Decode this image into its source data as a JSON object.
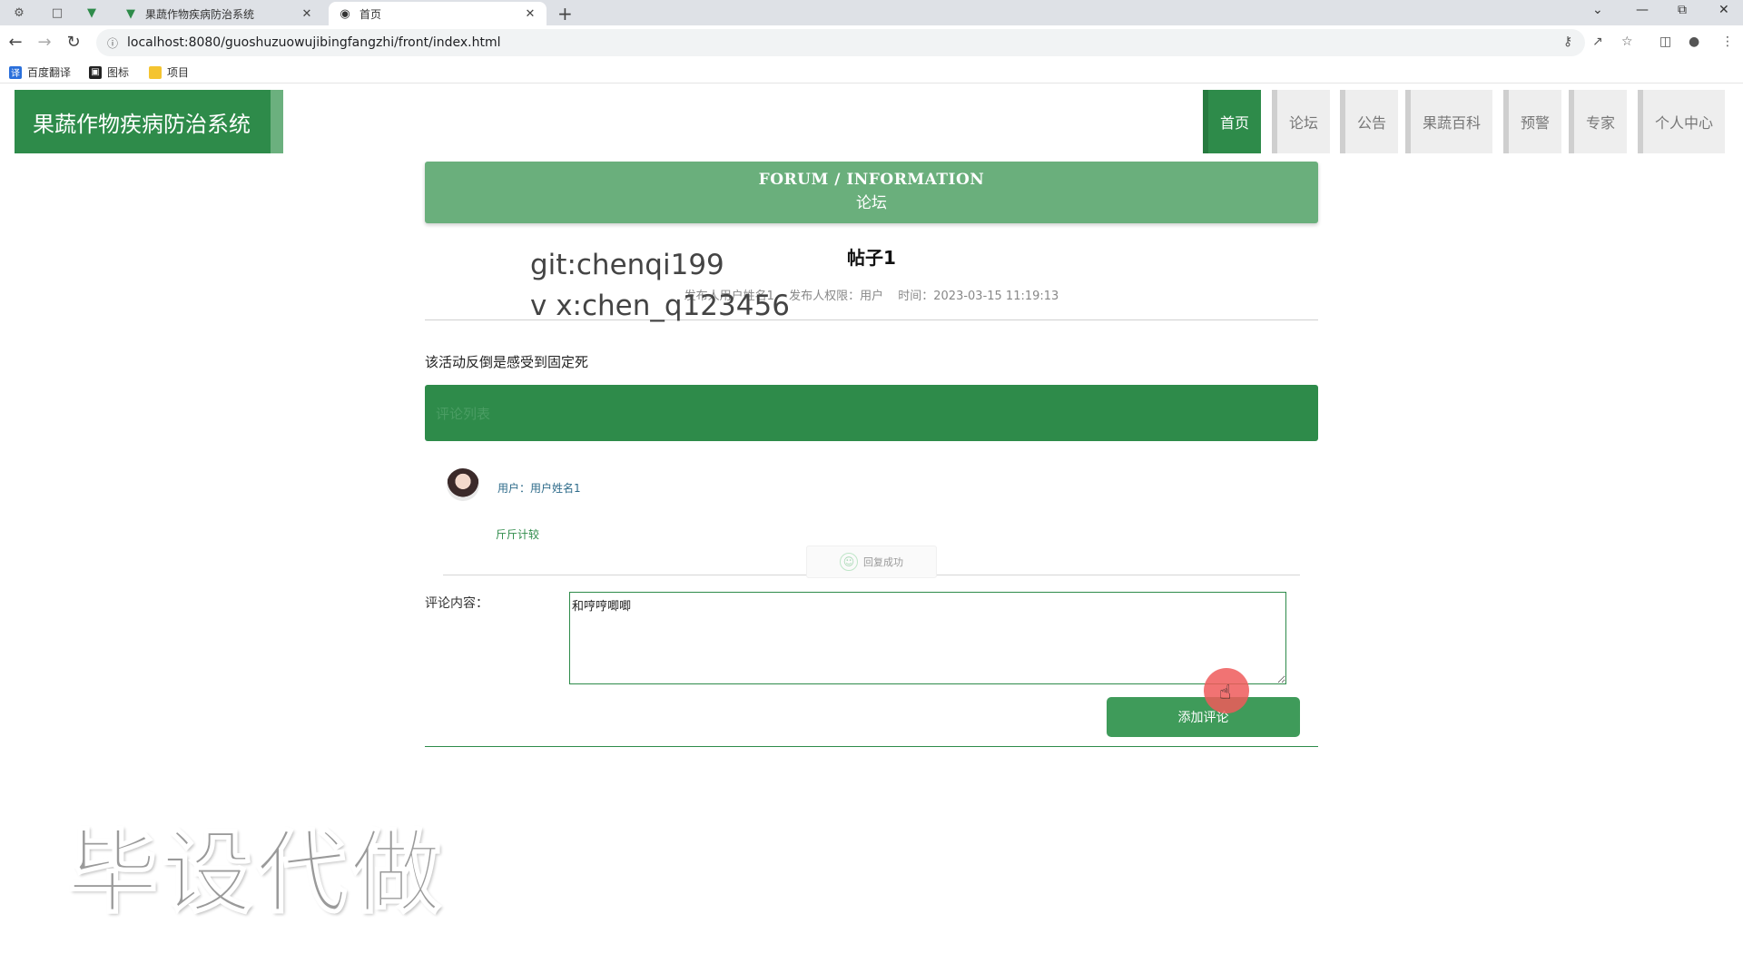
{
  "browser": {
    "tabs": [
      {
        "title": "果蔬作物疾病防治系统",
        "icon": "vue-icon"
      },
      {
        "title": "首页",
        "icon": "globe-icon"
      }
    ],
    "url": "localhost:8080/guoshuzuowujibingfangzhi/front/index.html",
    "bookmarks": [
      {
        "label": "百度翻译",
        "icon": "translate-icon",
        "color": "#2a6fdb"
      },
      {
        "label": "图标",
        "icon": "image-icon",
        "color": "#222222"
      },
      {
        "label": "项目",
        "icon": "folder-icon",
        "color": "#f4c430"
      }
    ]
  },
  "site": {
    "logo": "果蔬作物疾病防治系统",
    "nav": [
      "首页",
      "论坛",
      "公告",
      "果蔬百科",
      "预警",
      "专家",
      "个人中心"
    ],
    "active_nav": "首页",
    "accent": "#2e8b4a"
  },
  "banner": {
    "en": "FORUM / INFORMATION",
    "cn": "论坛"
  },
  "post": {
    "title": "帖子1",
    "author": "发布人用户姓名1",
    "role": "发布人权限：用户",
    "time": "时间：2023-03-15 11:19:13",
    "content": "该活动反倒是感受到固定死"
  },
  "comments": {
    "header": "评论列表",
    "items": [
      {
        "user": "用户：用户姓名1",
        "content": "斤斤计较"
      }
    ]
  },
  "toast": "回复成功",
  "form": {
    "label": "评论内容：",
    "value": "和哼哼唧唧",
    "submit": "添加评论"
  },
  "watermarks": {
    "git_line1": "git:chenqi199",
    "git_line2": "v x:chen_q123456",
    "big": "毕设代做"
  }
}
